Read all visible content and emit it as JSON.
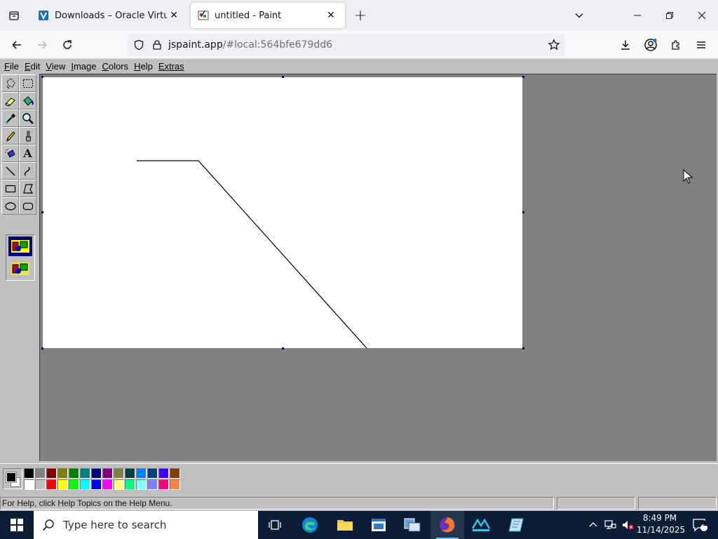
{
  "browser": {
    "tabs": [
      {
        "title": "Downloads – Oracle VirtualBox",
        "active": false
      },
      {
        "title": "untitled - Paint",
        "active": true
      }
    ],
    "url_host": "jspaint.app",
    "url_path": "/#local:564bfe679dd6"
  },
  "paint": {
    "menus": [
      {
        "first": "F",
        "rest": "ile"
      },
      {
        "first": "E",
        "rest": "dit"
      },
      {
        "first": "V",
        "rest": "iew"
      },
      {
        "first": "I",
        "rest": "mage"
      },
      {
        "first": "C",
        "rest": "olors"
      },
      {
        "first": "H",
        "rest": "elp"
      },
      {
        "first": "",
        "rest": "Extras"
      }
    ],
    "tools": [
      "free-form-select",
      "select",
      "eraser",
      "fill-with-color",
      "pick-color",
      "magnifier",
      "pencil",
      "brush",
      "airbrush",
      "text",
      "line",
      "curve",
      "rectangle",
      "polygon",
      "ellipse",
      "rounded-rectangle"
    ],
    "text_tool_glyph": "A",
    "foreground_color": "#000000",
    "background_color": "#ffffff",
    "palette_top": [
      "#000000",
      "#808080",
      "#800000",
      "#808000",
      "#008000",
      "#008080",
      "#000080",
      "#800080",
      "#808040",
      "#004040",
      "#0080ff",
      "#004080",
      "#4000ff",
      "#804000"
    ],
    "palette_bottom": [
      "#ffffff",
      "#c0c0c0",
      "#ff0000",
      "#ffff00",
      "#00ff00",
      "#00ffff",
      "#0000ff",
      "#ff00ff",
      "#ffff80",
      "#00ff80",
      "#80ffff",
      "#8080ff",
      "#ff0080",
      "#ff8040"
    ],
    "status_text": "For Help, click Help Topics on the Help Menu."
  },
  "taskbar": {
    "search_placeholder": "Type here to search",
    "time": "8:49 PM",
    "date": "11/14/2025",
    "notification_count": "1"
  }
}
